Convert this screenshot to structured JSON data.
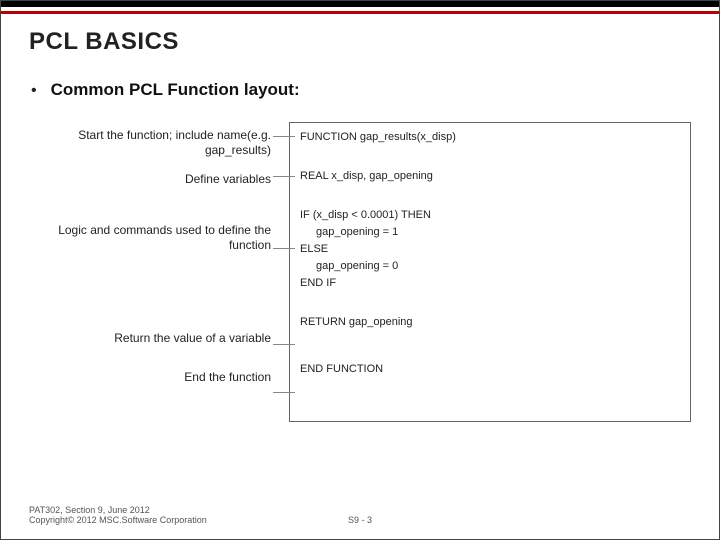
{
  "title": "PCL BASICS",
  "bullet": "Common PCL Function layout:",
  "labels": {
    "start": "Start the function; include name(e.g. gap_results)",
    "define": "Define variables",
    "logic": "Logic and commands used to define the function",
    "ret": "Return the value of a variable",
    "end": "End the function"
  },
  "code": {
    "l1": "FUNCTION gap_results(x_disp)",
    "l2": "REAL x_disp, gap_opening",
    "l3": "IF (x_disp < 0.0001) THEN",
    "l4": "gap_opening = 1",
    "l5": "ELSE",
    "l6": "gap_opening = 0",
    "l7": "END IF",
    "l8": "RETURN gap_opening",
    "l9": "END FUNCTION"
  },
  "footer": {
    "left1": "PAT302, Section 9, June 2012",
    "left2": "Copyright© 2012 MSC.Software Corporation",
    "page": "S9 - 3"
  }
}
